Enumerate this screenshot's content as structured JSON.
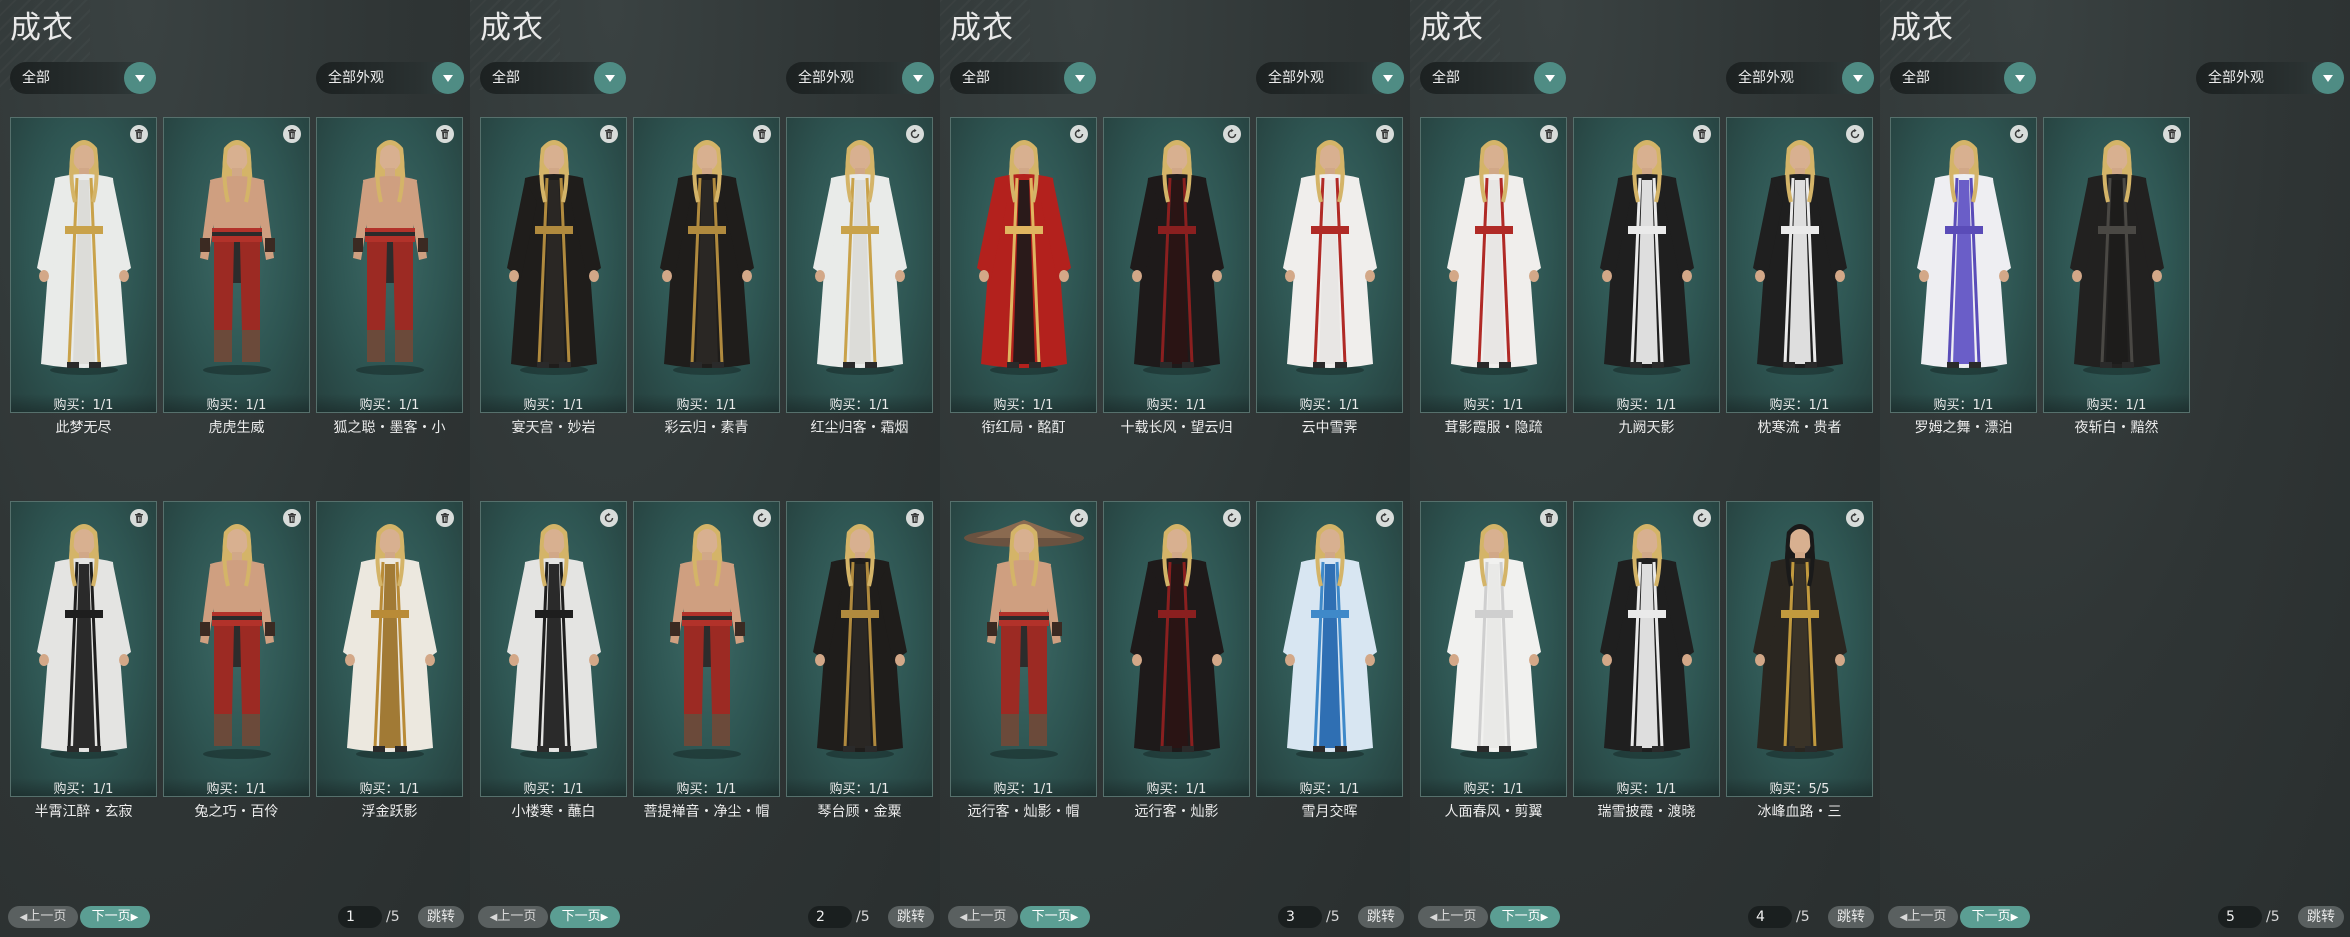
{
  "labels": {
    "title": "成衣",
    "filter_left": "全部",
    "filter_right": "全部外观",
    "prev": "上一页",
    "next": "下一页",
    "jump": "跳转",
    "total": "/5"
  },
  "panels": [
    {
      "page": "1",
      "items": [
        {
          "name": "此梦无尽",
          "buy": "购买：1/1",
          "icon": "trash-icon",
          "style": "white-gold"
        },
        {
          "name": "虎虎生威",
          "buy": "购买：1/1",
          "icon": "trash-icon",
          "style": "bare-red"
        },
        {
          "name": "狐之聪・墨客・小",
          "buy": "购买：1/1",
          "icon": "trash-icon",
          "style": "bare-red"
        },
        {
          "name": "半霄江醉・玄寂",
          "buy": "购买：1/1",
          "icon": "trash-icon",
          "style": "white-black"
        },
        {
          "name": "兔之巧・百伶",
          "buy": "购买：1/1",
          "icon": "trash-icon",
          "style": "bare-red"
        },
        {
          "name": "浮金跃影",
          "buy": "购买：1/1",
          "icon": "trash-icon",
          "style": "gold-white"
        }
      ]
    },
    {
      "page": "2",
      "items": [
        {
          "name": "宴天宫・妙岩",
          "buy": "购买：1/1",
          "icon": "trash-icon",
          "style": "black-gold"
        },
        {
          "name": "彩云归・素青",
          "buy": "购买：1/1",
          "icon": "trash-icon",
          "style": "black-gold"
        },
        {
          "name": "红尘归客・霜烟",
          "buy": "购买：1/1",
          "icon": "refresh-icon",
          "style": "white-gold"
        },
        {
          "name": "小楼寒・蘸白",
          "buy": "购买：1/1",
          "icon": "refresh-icon",
          "style": "white-black"
        },
        {
          "name": "菩提禅音・净尘・帽",
          "buy": "购买：1/1",
          "icon": "refresh-icon",
          "style": "bare-red"
        },
        {
          "name": "琴台顾・金粟",
          "buy": "购买：1/1",
          "icon": "trash-icon",
          "style": "black-gold"
        }
      ]
    },
    {
      "page": "3",
      "items": [
        {
          "name": "衔红局・酩酊",
          "buy": "购买：1/1",
          "icon": "refresh-icon",
          "style": "red"
        },
        {
          "name": "十载长风・望云归",
          "buy": "购买：1/1",
          "icon": "refresh-icon",
          "style": "black-red"
        },
        {
          "name": "云中雪霁",
          "buy": "购买：1/1",
          "icon": "trash-icon",
          "style": "white-red"
        },
        {
          "name": "远行客・灿影・帽",
          "buy": "购买：1/1",
          "icon": "refresh-icon",
          "style": "bare-hat"
        },
        {
          "name": "远行客・灿影",
          "buy": "购买：1/1",
          "icon": "refresh-icon",
          "style": "black-red"
        },
        {
          "name": "雪月交晖",
          "buy": "购买：1/1",
          "icon": "refresh-icon",
          "style": "blue"
        }
      ]
    },
    {
      "page": "4",
      "items": [
        {
          "name": "茸影霞服・隐疏",
          "buy": "购买：1/1",
          "icon": "trash-icon",
          "style": "white-red"
        },
        {
          "name": "九阙天影",
          "buy": "购买：1/1",
          "icon": "trash-icon",
          "style": "black-white"
        },
        {
          "name": "枕寒流・贵者",
          "buy": "购买：1/1",
          "icon": "refresh-icon",
          "style": "black-white"
        },
        {
          "name": "人面春风・剪翼",
          "buy": "购买：1/1",
          "icon": "trash-icon",
          "style": "white"
        },
        {
          "name": "瑞雪披霞・渡晓",
          "buy": "购买：1/1",
          "icon": "refresh-icon",
          "style": "black-white"
        },
        {
          "name": "冰峰血路・三",
          "buy": "购买：5/5",
          "icon": "refresh-icon",
          "style": "dark-gold"
        }
      ]
    },
    {
      "page": "5",
      "items": [
        {
          "name": "罗姆之舞・漂泊",
          "buy": "购买：1/1",
          "icon": "refresh-icon",
          "style": "white-purple"
        },
        {
          "name": "夜斩白・黯然",
          "buy": "购买：1/1",
          "icon": "trash-icon",
          "style": "black"
        }
      ]
    }
  ],
  "colors": {
    "accent": "#5b9e93",
    "card_bg": "#2e5552",
    "page_bg": "#2c3333"
  }
}
